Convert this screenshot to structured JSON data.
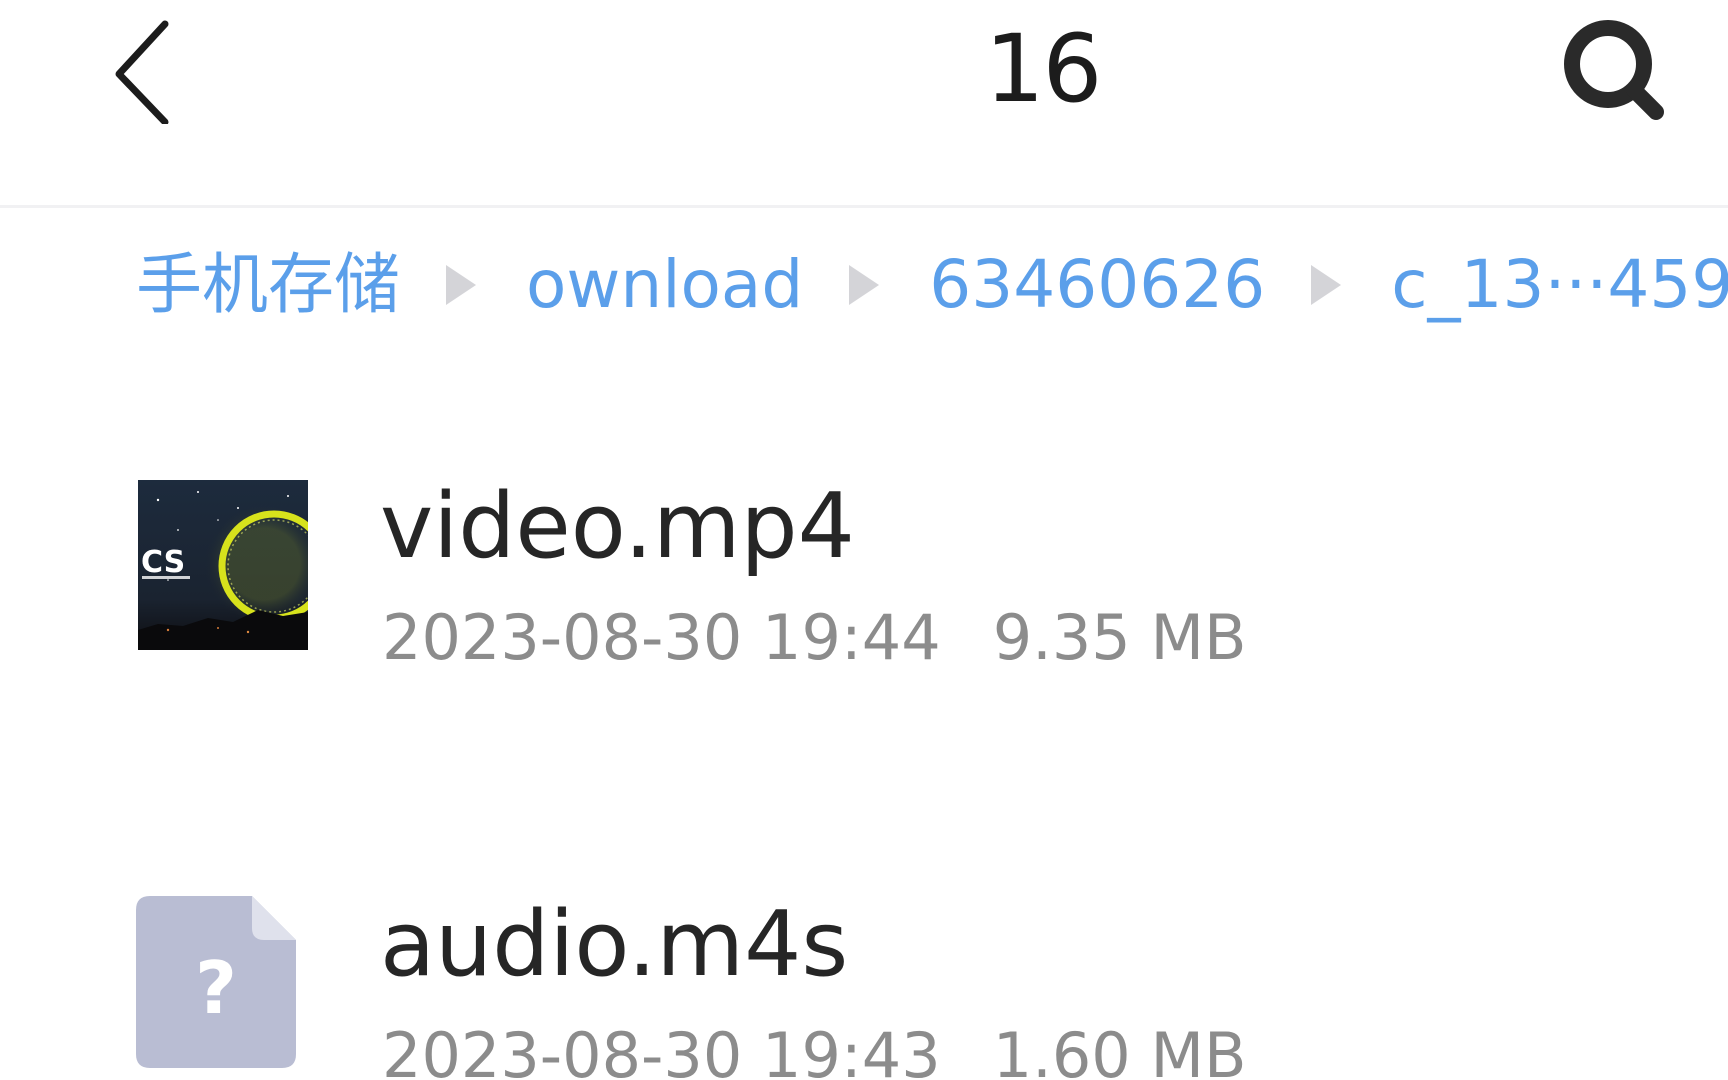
{
  "header": {
    "title": "16",
    "back_icon": "chevron-left-icon",
    "search_icon": "search-icon"
  },
  "breadcrumb": [
    {
      "label": "手机存储"
    },
    {
      "label": "ownload"
    },
    {
      "label": "63460626"
    },
    {
      "label": "c_13···459"
    }
  ],
  "files": [
    {
      "name": "video.mp4",
      "date": "2023-08-30 19:44",
      "size": "9.35 MB",
      "icon": "video-thumbnail",
      "thumb_text": "CS"
    },
    {
      "name": "audio.m4s",
      "date": "2023-08-30 19:43",
      "size": "1.60 MB",
      "icon": "unknown-file-icon",
      "icon_glyph": "?"
    }
  ],
  "colors": {
    "accent": "#5b9fea",
    "text_primary": "#262626",
    "text_secondary": "#8c8c8c",
    "unknown_icon_fill": "#b9bdd3"
  }
}
